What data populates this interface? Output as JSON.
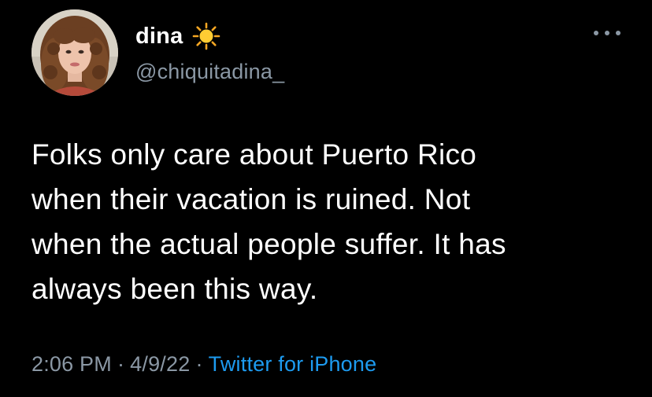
{
  "author": {
    "display_name": "dina",
    "handle": "@chiquitadina_",
    "name_emoji": "sun-emoji",
    "avatar": "profile-photo"
  },
  "tweet": {
    "lines": [
      "Folks only care about Puerto Rico",
      "when their vacation is ruined. Not",
      "when the actual people suffer. It has",
      "always been this way."
    ]
  },
  "meta": {
    "time": "2:06 PM",
    "separator": "·",
    "date": "4/9/22",
    "source": "Twitter for iPhone"
  },
  "colors": {
    "background": "#000000",
    "text": "#ffffff",
    "secondary": "#8b98a5",
    "link": "#1d9bf0"
  },
  "icons": {
    "more": "more-horizontal-icon"
  }
}
